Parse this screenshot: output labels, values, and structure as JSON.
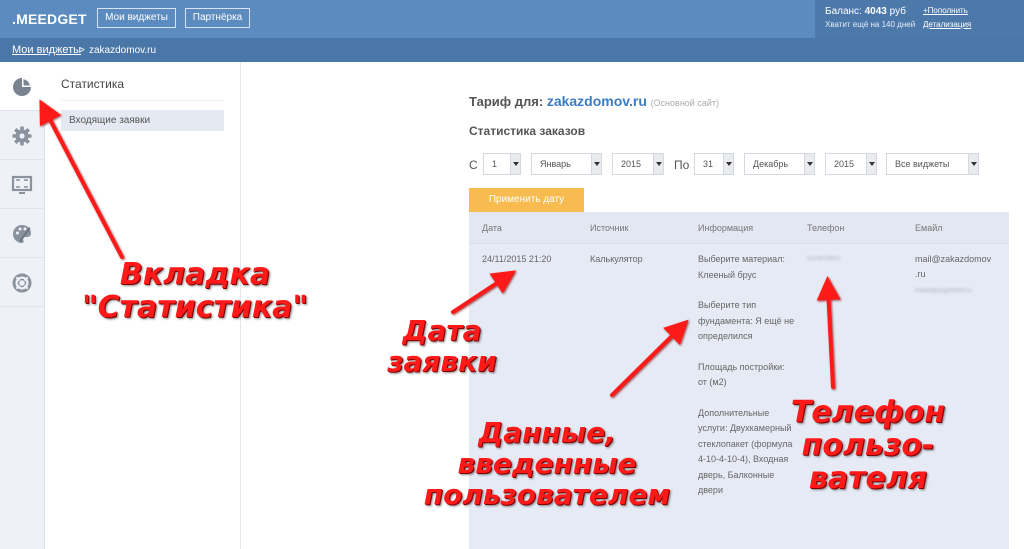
{
  "header": {
    "logo": ".MEEDGET",
    "nav": {
      "widgets_label": "Мои виджеты",
      "partner_label": "Партнёрка"
    },
    "balance": {
      "label": "Баланс:",
      "amount": "4043",
      "currency": "руб",
      "days_note": "Хватит ещё на 140 дней",
      "topup_label": "+Пополнить",
      "details_label": "Детализация"
    }
  },
  "breadcrumb": {
    "link": "Мои виджеты",
    "separator": ">",
    "current": "zakazdomov.ru"
  },
  "icon_sidebar": [
    "pie-chart-icon",
    "gear-icon",
    "monitor-icon",
    "palette-icon",
    "lifebuoy-icon"
  ],
  "sub_sidebar": {
    "title": "Статистика",
    "items": [
      {
        "label": "Входящие заявки"
      }
    ]
  },
  "main": {
    "tariff_label": "Тариф для:",
    "site": "zakazdomov.ru",
    "site_note": "(Основной сайт)",
    "section_title": "Статистика заказов",
    "filters": {
      "from_label": "С",
      "from_day": "1",
      "from_month": "Январь",
      "from_year": "2015",
      "to_label": "По",
      "to_day": "31",
      "to_month": "Декабрь",
      "to_year": "2015",
      "widget": "Все виджеты"
    },
    "apply_label": "Применить дату",
    "colors": {
      "accent": "#f7bb4f",
      "header": "#5b8bbf",
      "breadcrumb": "#4a76a8",
      "annotation": "#ff1a1a"
    }
  },
  "table": {
    "headers": [
      "Дата",
      "Источник",
      "Информация",
      "Телефон",
      "Емайл"
    ],
    "row": {
      "date": "24/11/2015 21:20",
      "source": "Калькулятор",
      "info": [
        "Выберите материал: Клееный брус",
        "Выберите тип фундамента: Я ещё не определился",
        "Площадь постройки: от (м2)",
        "Дополнительные услуги: Двухкамерный стеклопакет (формула 4-10-4-10-4), Входная дверь, Балконные двери"
      ],
      "phone": "9114929900",
      "email_1": "mail@zakazdomov",
      "email_2": ".ru",
      "email_3": "mihail@yuguhrilfut.ru"
    }
  },
  "annotations": {
    "tab_line1": "Вкладка",
    "tab_line2": "\"Статистика\"",
    "date_line1": "Дата",
    "date_line2": "заявки",
    "data_line1": "Данные,",
    "data_line2": "введенные",
    "data_line3": "пользователем",
    "phone_line1": "Телефон",
    "phone_line2": "пользо-",
    "phone_line3": "вателя"
  }
}
